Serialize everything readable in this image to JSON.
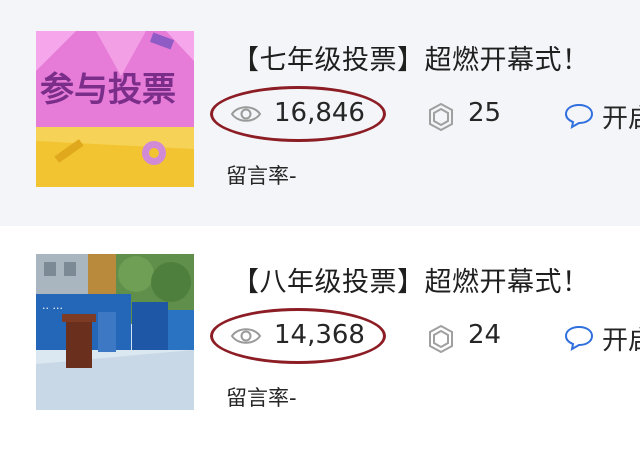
{
  "articles": [
    {
      "thumbnail_text": "参与投票",
      "title": "【七年级投票】超燃开幕式！",
      "views": "16,846",
      "likes": "25",
      "comment_label": "开启",
      "rate_label": "留言率",
      "rate_value": "-"
    },
    {
      "thumbnail_text": "",
      "title": "【八年级投票】超燃开幕式！",
      "views": "14,368",
      "likes": "24",
      "comment_label": "开启",
      "rate_label": "留言率",
      "rate_value": "-"
    }
  ],
  "icons": [
    "eye-icon",
    "like-icon",
    "comment-icon"
  ],
  "colors": {
    "highlight_oval": "#8c1d25",
    "thumb1_bg": "#e878d6",
    "thumb1_band": "#f2c431"
  }
}
